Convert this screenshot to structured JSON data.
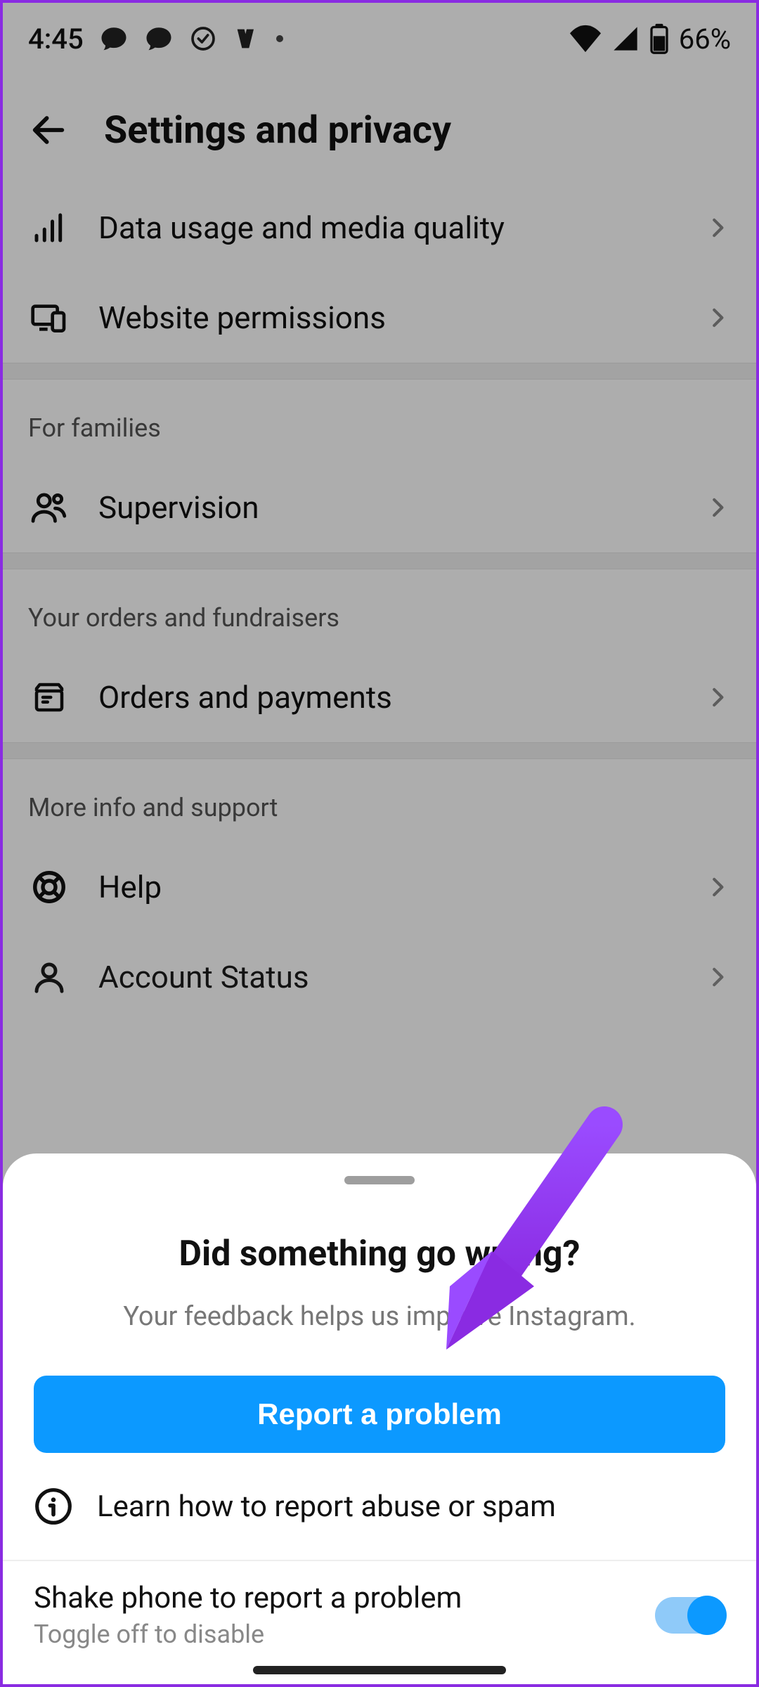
{
  "status": {
    "time": "4:45",
    "battery_pct": "66%"
  },
  "header": {
    "title": "Settings and privacy"
  },
  "settings_list": {
    "row_data_media": "Data usage and media quality",
    "row_website_perm": "Website permissions",
    "section_families": "For families",
    "row_supervision": "Supervision",
    "section_orders": "Your orders and fundraisers",
    "row_orders": "Orders and payments",
    "section_support": "More info and support",
    "row_help": "Help",
    "row_account_status": "Account Status"
  },
  "sheet": {
    "title": "Did something go wrong?",
    "subtitle": "Your feedback helps us improve Instagram.",
    "primary_button": "Report a problem",
    "learn_row": "Learn how to report abuse or spam",
    "shake_title": "Shake phone to report a problem",
    "shake_sub": "Toggle off to disable",
    "shake_toggle_on": true
  },
  "annotation": {
    "arrow_color": "#9a4bff"
  }
}
